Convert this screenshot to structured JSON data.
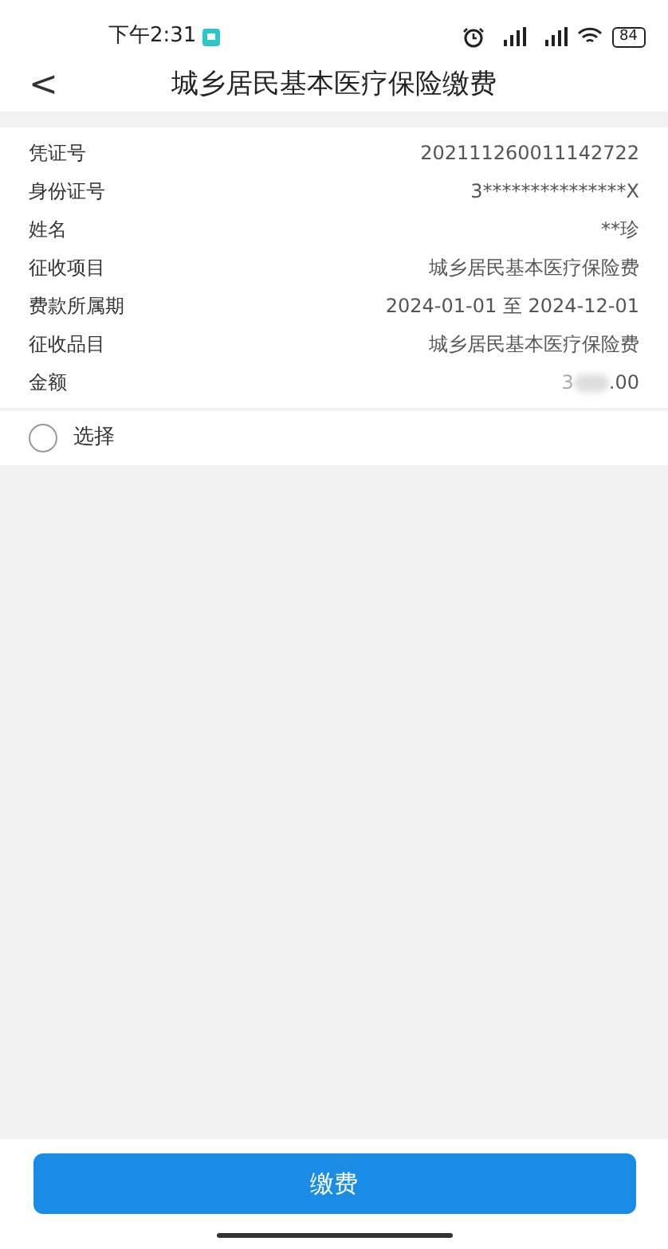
{
  "status_bar": {
    "time": "下午2:31",
    "battery": "84"
  },
  "header": {
    "back": "<",
    "title": "城乡居民基本医疗保险缴费"
  },
  "details": [
    {
      "label": "凭证号",
      "value": "202111260011142722"
    },
    {
      "label": "身份证号",
      "value": "3***************X"
    },
    {
      "label": "姓名",
      "value": "**珍"
    },
    {
      "label": "征收项目",
      "value": "城乡居民基本医疗保险费"
    },
    {
      "label": "费款所属期",
      "value": "2024-01-01 至 2024-12-01"
    },
    {
      "label": "征收品目",
      "value": "城乡居民基本医疗保险费"
    },
    {
      "label": "金额",
      "kind": "redacted",
      "value_parts": [
        "3",
        ".00"
      ]
    }
  ],
  "select": {
    "label": "选择",
    "checked": false
  },
  "pay_button": "缴费"
}
